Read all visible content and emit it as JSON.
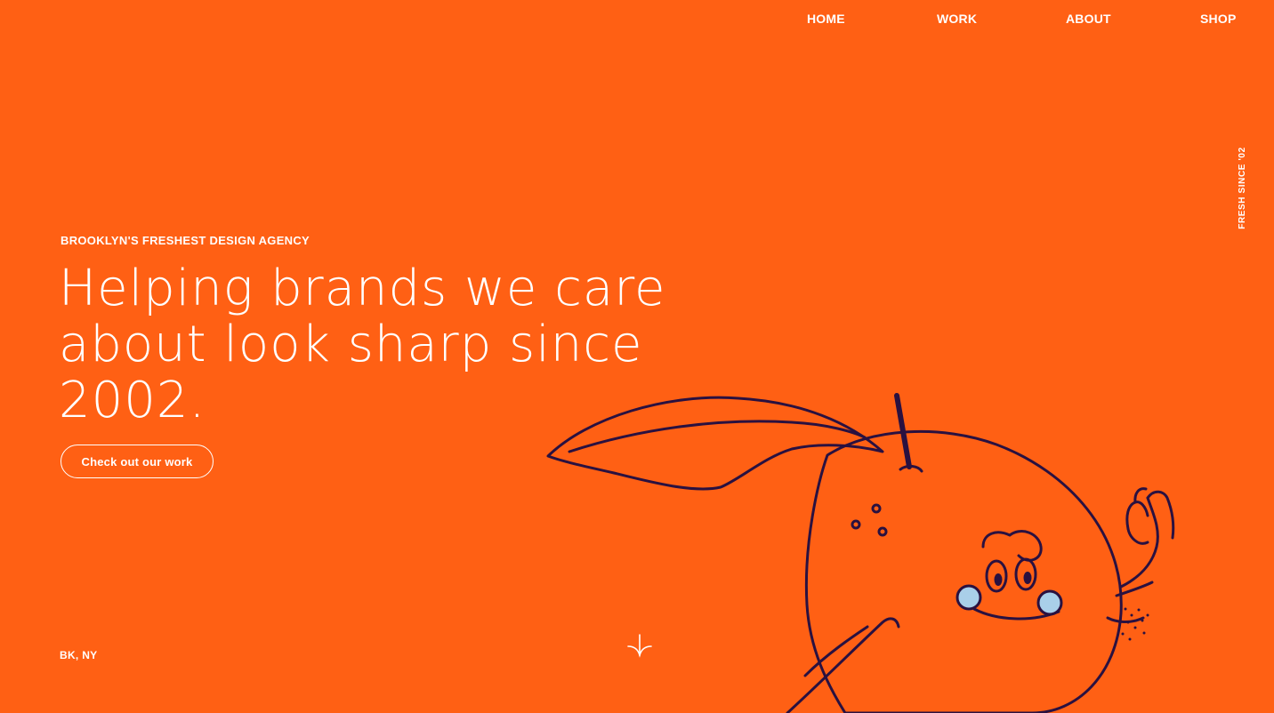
{
  "nav": {
    "items": [
      {
        "label": "HOME"
      },
      {
        "label": "WORK"
      },
      {
        "label": "ABOUT"
      },
      {
        "label": "SHOP"
      }
    ]
  },
  "side_tag": "FRESH SINCE '02",
  "hero": {
    "eyebrow": "BROOKLYN'S FRESHEST DESIGN AGENCY",
    "headline": "Helping brands we care about look sharp since 2002.",
    "cta_label": "Check out our work"
  },
  "footer": {
    "location": "BK, NY"
  },
  "icons": {
    "scroll": "scroll-down-arrow-icon",
    "mascot": "orange-mascot-illustration"
  },
  "colors": {
    "background": "#FF6014",
    "text": "#FFFFFF",
    "ink": "#2A1140",
    "cheek": "#A9CFE9"
  }
}
